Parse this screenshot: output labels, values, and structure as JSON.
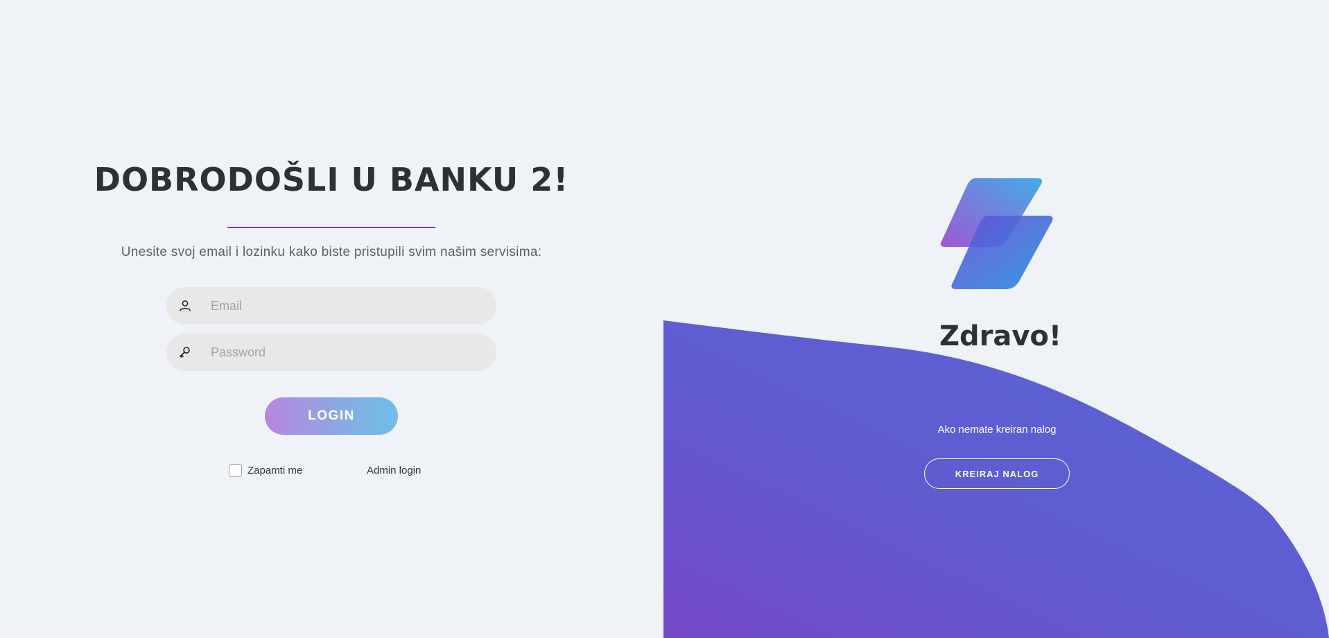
{
  "login": {
    "heading": "DOBRODOŠLI U BANKU 2!",
    "subtitle": "Unesite svoj email i lozinku kako biste pristupili svim našim servisima:",
    "email": {
      "placeholder": "Email",
      "value": "",
      "icon": "user-icon"
    },
    "password": {
      "placeholder": "Password",
      "value": "",
      "icon": "key-icon"
    },
    "login_label": "LOGIN",
    "remember_label": "Zapamti me",
    "remember_checked": false,
    "admin_label": "Admin login"
  },
  "welcome": {
    "logo_icon": "bank-logo-icon",
    "greeting": "Zdravo!",
    "no_account_text": "Ako nemate kreiran nalog",
    "create_label": "KREIRAJ NALOG"
  },
  "colors": {
    "background": "#eff2f7",
    "accent_purple": "#7b33d1",
    "wave_top": "#5d63d3",
    "wave_bottom": "#7549c9",
    "login_gradient_start": "#b985dc",
    "login_gradient_end": "#6dbfe8",
    "heading_text": "#2e3032"
  }
}
